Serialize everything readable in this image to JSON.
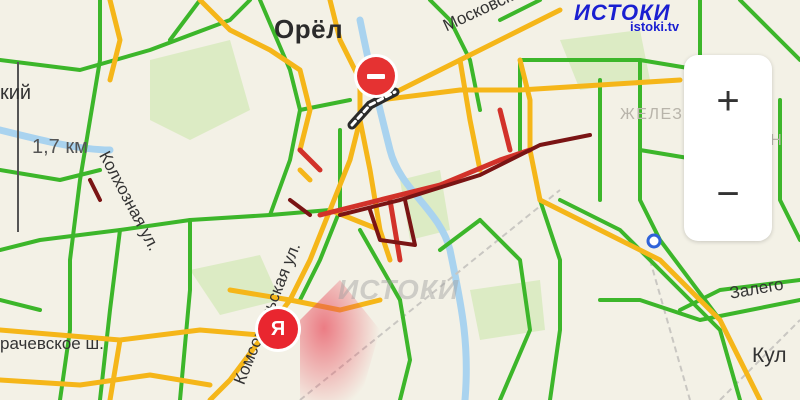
{
  "map": {
    "city": "Орёл",
    "streets": {
      "moskovskaya": "Московск",
      "kolkhoznaya": "Колхозная ул.",
      "komsomolskaya": "Комсомольская ул.",
      "karachevskoe": "рачевское ш.",
      "zalegoshch": "Залего",
      "kul": "Кул",
      "partial_left": "кий"
    },
    "district": [
      "ЖЕЛЕЗНОДОР",
      "РАЙОН"
    ],
    "scale_label": "1,7 км"
  },
  "controls": {
    "zoom_in": "+",
    "zoom_out": "−"
  },
  "watermark": {
    "logo": "ИСТОКИ",
    "site": "istoki.tv",
    "center": "ИСТОКИ"
  },
  "markers": {
    "yandex": "Я"
  },
  "colors": {
    "free": "#3cb62a",
    "slow": "#f5b619",
    "jam": "#d2322a",
    "heavy": "#7a1414",
    "river": "#a6d1ef",
    "park": "#d9eac1"
  }
}
